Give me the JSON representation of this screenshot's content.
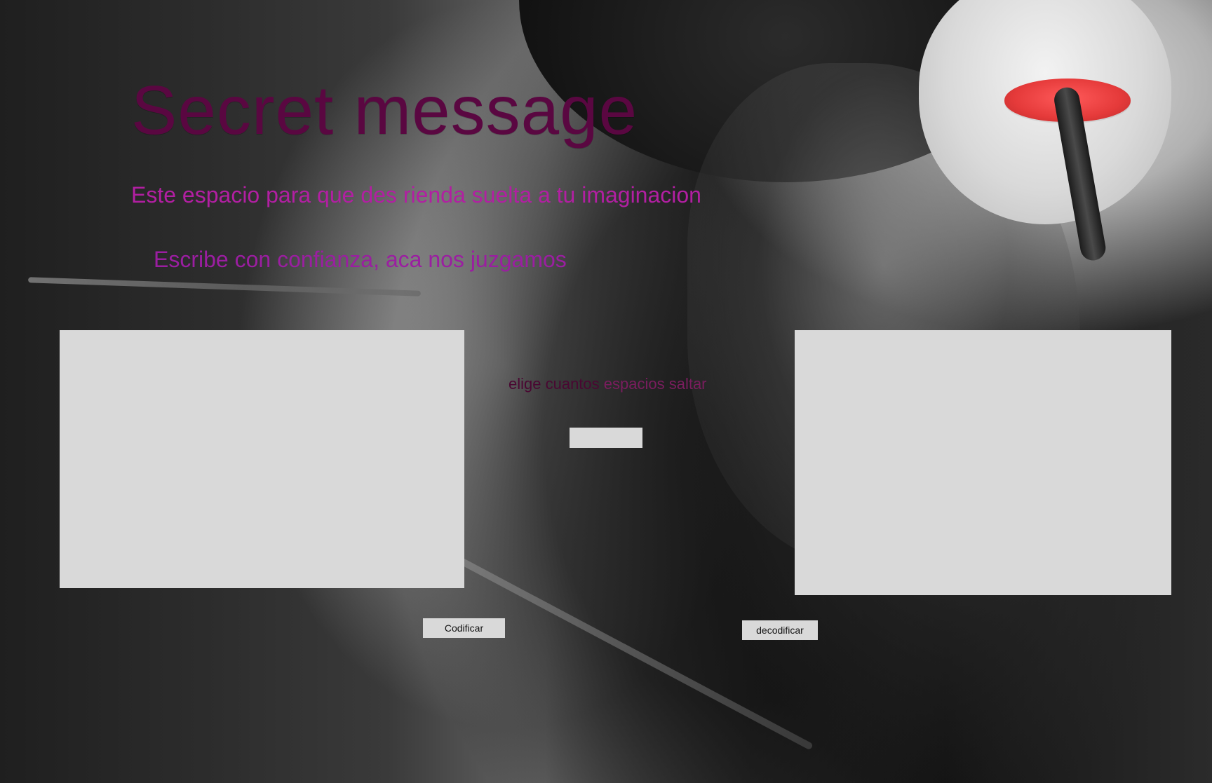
{
  "header": {
    "title": "Secret message",
    "subtitle": "Este espacio para que des rienda suelta a tu imaginacion",
    "prompt": "Escribe con confianza, aca nos juzgamos"
  },
  "controls": {
    "offset_label_part1": "elige cuantos",
    "offset_label_part2": " espacios saltar",
    "encode_button_label": "Codificar",
    "decode_button_label": "decodificar"
  },
  "fields": {
    "input_left_value": "",
    "input_right_value": "",
    "offset_value": ""
  },
  "colors": {
    "title": "#5a0741",
    "subtitle": "#b21fa2",
    "prompt": "#9b1ea1",
    "field_background": "#d9d9d9",
    "lips_red": "#e53a3a"
  }
}
